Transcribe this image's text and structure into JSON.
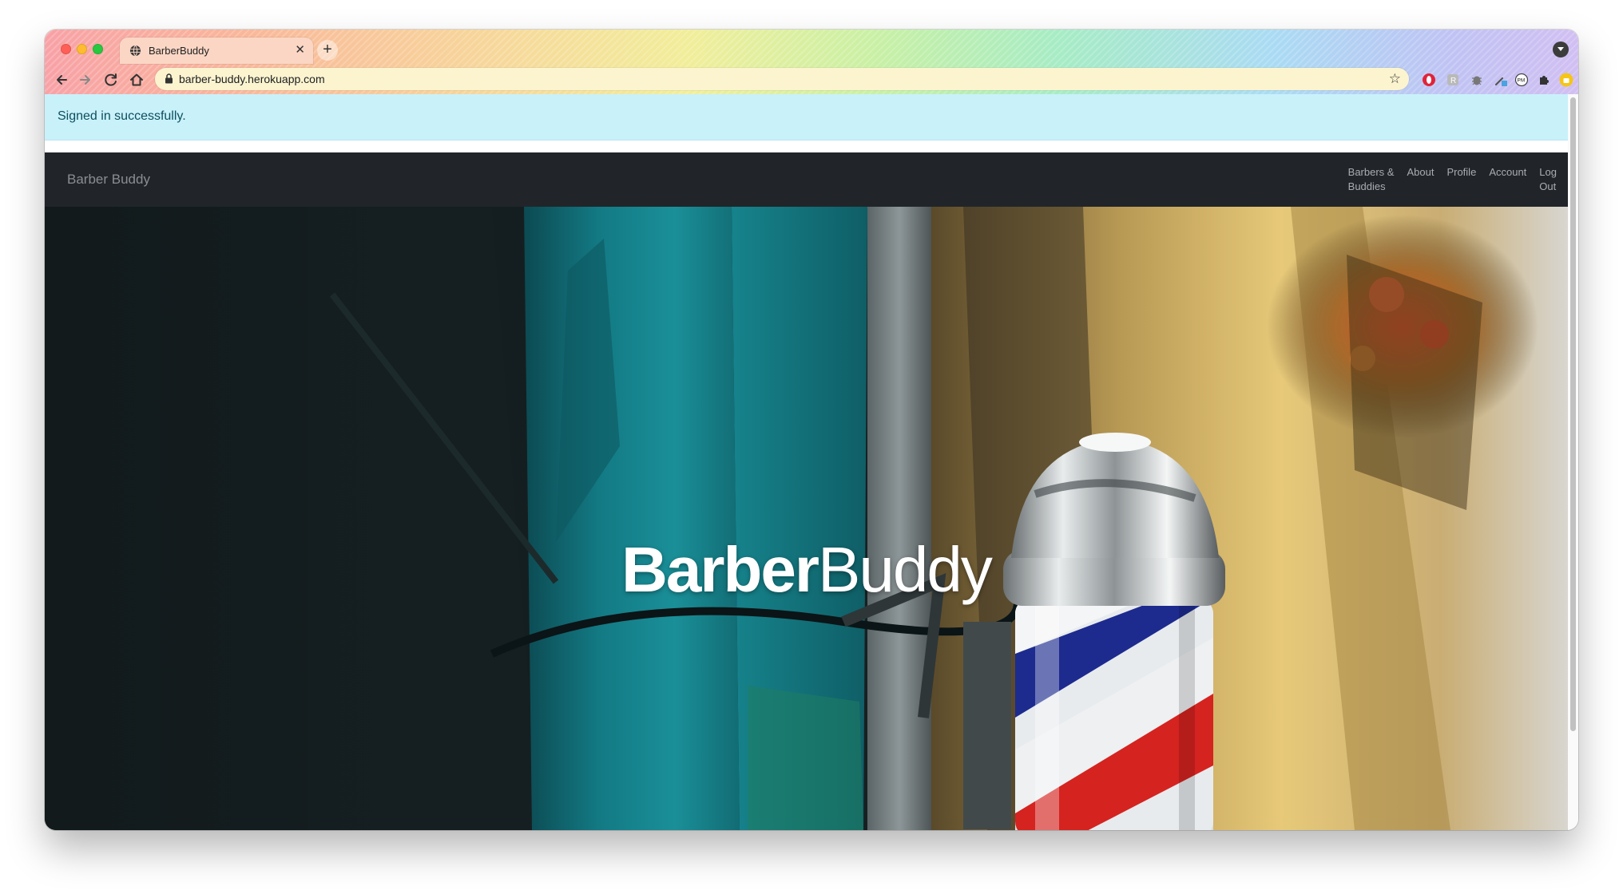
{
  "browser": {
    "tab": {
      "title": "BarberBuddy",
      "favicon": "globe-icon",
      "close_icon": "close-icon"
    },
    "new_tab_icon": "plus-icon",
    "tab_search_icon": "chevron-down-icon",
    "url": "barber-buddy.herokuapp.com",
    "nav_icons": [
      "back-arrow-icon",
      "forward-arrow-icon",
      "reload-icon",
      "home-icon"
    ],
    "extensions": [
      "opera-icon",
      "reader-icon",
      "bug-icon",
      "dropper-icon",
      "pm-icon",
      "puzzle-icon",
      "profile-icon",
      "more-icon"
    ],
    "colors": {
      "omnibox_bg": "#fbf4cf",
      "tab_bg": "#fbd6c4"
    }
  },
  "page": {
    "alert": {
      "text": "Signed in successfully.",
      "bg_color": "#c9f1fa",
      "text_color": "#0c4f5d"
    },
    "navbar": {
      "brand": "Barber Buddy",
      "bg_color": "#212529",
      "links": [
        {
          "line1": "Barbers &",
          "line2": "Buddies"
        },
        {
          "line1": "About",
          "line2": ""
        },
        {
          "line1": "Profile",
          "line2": ""
        },
        {
          "line1": "Account",
          "line2": ""
        },
        {
          "line1": "Log",
          "line2": "Out"
        }
      ]
    },
    "hero": {
      "title_bold": "Barber",
      "title_light": "Buddy",
      "image": "barber-pole-photo"
    }
  }
}
